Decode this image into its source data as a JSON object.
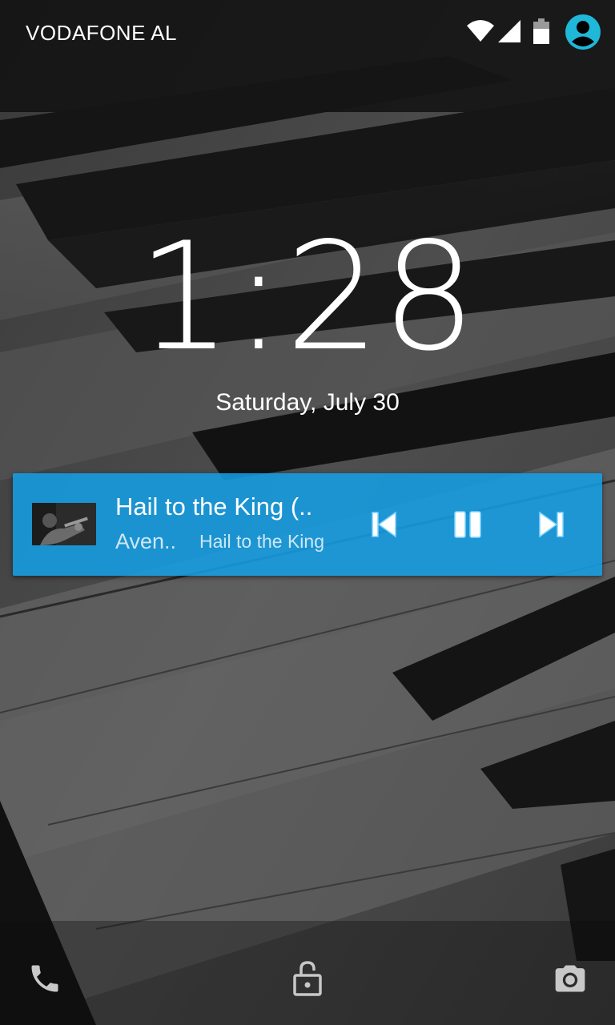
{
  "status_bar": {
    "carrier": "VODAFONE AL",
    "icons": [
      "wifi-icon",
      "signal-icon",
      "battery-icon",
      "user-icon"
    ],
    "user_icon_color": "#1fb8d8"
  },
  "lockscreen": {
    "time": "1:28",
    "date": "Saturday, July 30"
  },
  "media": {
    "title": "Hail to the King (..",
    "artist": "Aven..",
    "album": "Hail to the King",
    "card_color": "#14a0e6",
    "controls": [
      "previous-icon",
      "pause-icon",
      "next-icon"
    ]
  },
  "shortcuts": [
    "phone-icon",
    "lock-open-icon",
    "camera-icon"
  ]
}
